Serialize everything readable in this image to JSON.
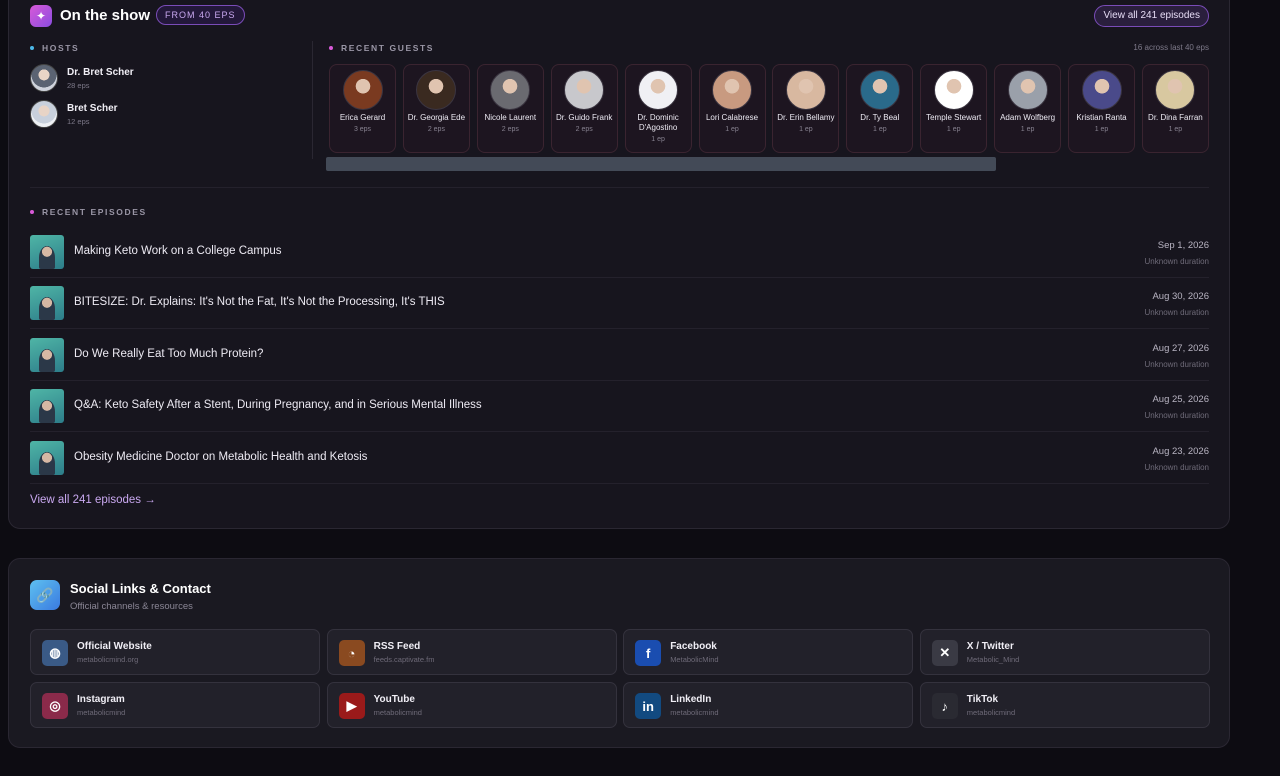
{
  "show": {
    "title": "On the show",
    "pill": "FROM 40 EPS",
    "view_all_top": "View all 241 episodes",
    "hosts_label": "HOSTS",
    "hosts": [
      {
        "name": "Dr. Bret Scher",
        "eps": "28 eps"
      },
      {
        "name": "Bret Scher",
        "eps": "12 eps"
      }
    ],
    "recent_guests_label": "RECENT GUESTS",
    "guests_count": "16 across last 40 eps",
    "guests": [
      {
        "name": "Erica Gerard",
        "eps": "3 eps"
      },
      {
        "name": "Dr. Georgia Ede",
        "eps": "2 eps"
      },
      {
        "name": "Nicole Laurent",
        "eps": "2 eps"
      },
      {
        "name": "Dr. Guido Frank",
        "eps": "2 eps"
      },
      {
        "name": "Dr. Dominic D'Agostino",
        "eps": "1 ep"
      },
      {
        "name": "Lori Calabrese",
        "eps": "1 ep"
      },
      {
        "name": "Dr. Erin Bellamy",
        "eps": "1 ep"
      },
      {
        "name": "Dr. Ty Beal",
        "eps": "1 ep"
      },
      {
        "name": "Temple Stewart",
        "eps": "1 ep"
      },
      {
        "name": "Adam Wolfberg",
        "eps": "1 ep"
      },
      {
        "name": "Kristian Ranta",
        "eps": "1 ep"
      },
      {
        "name": "Dr. Dina Farran",
        "eps": "1 ep"
      }
    ],
    "recent_episodes_label": "RECENT EPISODES",
    "episodes": [
      {
        "title": "Making Keto Work on a College Campus",
        "date": "Sep 1, 2026",
        "duration": "Unknown duration"
      },
      {
        "title": "BITESIZE: Dr. Explains: It's Not the Fat, It's Not the Processing, It's THIS",
        "date": "Aug 30, 2026",
        "duration": "Unknown duration"
      },
      {
        "title": "Do We Really Eat Too Much Protein?",
        "date": "Aug 27, 2026",
        "duration": "Unknown duration"
      },
      {
        "title": "Q&A: Keto Safety After a Stent, During Pregnancy, and in Serious Mental Illness",
        "date": "Aug 25, 2026",
        "duration": "Unknown duration"
      },
      {
        "title": "Obesity Medicine Doctor on Metabolic Health and Ketosis",
        "date": "Aug 23, 2026",
        "duration": "Unknown duration"
      }
    ],
    "view_all_bottom": "View all 241 episodes →"
  },
  "social": {
    "title": "Social Links & Contact",
    "subtitle": "Official channels & resources",
    "links": [
      {
        "name": "Official Website",
        "handle": "metabolicmind.org",
        "icon": "globe-icon",
        "color": "#3a5a86"
      },
      {
        "name": "RSS Feed",
        "handle": "feeds.captivate.fm",
        "icon": "rss-icon",
        "color": "#8a4a20"
      },
      {
        "name": "Facebook",
        "handle": "MetabolicMind",
        "icon": "facebook-icon",
        "color": "#1a4db0"
      },
      {
        "name": "X / Twitter",
        "handle": "Metabolic_Mind",
        "icon": "x-twitter-icon",
        "color": "#3a3a44"
      },
      {
        "name": "Instagram",
        "handle": "metabolicmind",
        "icon": "instagram-icon",
        "color": "#8a2a4a"
      },
      {
        "name": "YouTube",
        "handle": "metabolicmind",
        "icon": "youtube-icon",
        "color": "#9a1a1a"
      },
      {
        "name": "LinkedIn",
        "handle": "metabolicmind",
        "icon": "linkedin-icon",
        "color": "#124a80"
      },
      {
        "name": "TikTok",
        "handle": "metabolicmind",
        "icon": "tiktok-icon",
        "color": "#2a2a32"
      }
    ]
  }
}
